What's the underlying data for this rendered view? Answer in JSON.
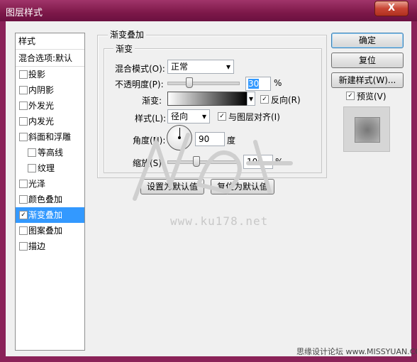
{
  "window": {
    "title": "图层样式",
    "close_glyph": "X"
  },
  "sidebar": {
    "header": "样式",
    "blend_options": "混合选项:默认",
    "items": [
      {
        "label": "投影",
        "checked": false
      },
      {
        "label": "内阴影",
        "checked": false
      },
      {
        "label": "外发光",
        "checked": false
      },
      {
        "label": "内发光",
        "checked": false
      },
      {
        "label": "斜面和浮雕",
        "checked": false
      },
      {
        "label": "等高线",
        "checked": false
      },
      {
        "label": "纹理",
        "checked": false
      },
      {
        "label": "光泽",
        "checked": false
      },
      {
        "label": "颜色叠加",
        "checked": false
      },
      {
        "label": "渐变叠加",
        "checked": true,
        "selected": true
      },
      {
        "label": "图案叠加",
        "checked": false
      },
      {
        "label": "描边",
        "checked": false
      }
    ]
  },
  "panel": {
    "outer_title": "渐变叠加",
    "inner_title": "渐变",
    "blend_mode_label": "混合模式(O):",
    "blend_mode_value": "正常",
    "opacity_label": "不透明度(P):",
    "opacity_value": "30",
    "opacity_unit": "%",
    "opacity_level": 0.3,
    "gradient_label": "渐变:",
    "reverse_label": "反向(R)",
    "reverse_checked": true,
    "style_label": "样式(L):",
    "style_value": "径向",
    "align_label": "与图层对齐(I)",
    "align_checked": true,
    "angle_label": "角度(N):",
    "angle_value": "90",
    "angle_unit": "度",
    "scale_label": "缩放(S):",
    "scale_value": "100",
    "scale_unit": "%",
    "scale_level": 0.4,
    "set_default_btn": "设置为默认值",
    "reset_default_btn": "复位为默认值"
  },
  "actions": {
    "ok": "确定",
    "reset": "复位",
    "new_style": "新建样式(W)...",
    "preview_label": "预览(V)",
    "preview_checked": true
  },
  "watermark": {
    "url": "www.ku178.net"
  },
  "footer": {
    "text": "思缘设计论坛  www.MISSYUAN.COM"
  },
  "colors": {
    "title_bar": "#7d1849",
    "selection": "#3399ff",
    "accent_button": "#3c7fb1"
  },
  "icons": {
    "checkmark": "✓",
    "dropdown": "▾"
  }
}
